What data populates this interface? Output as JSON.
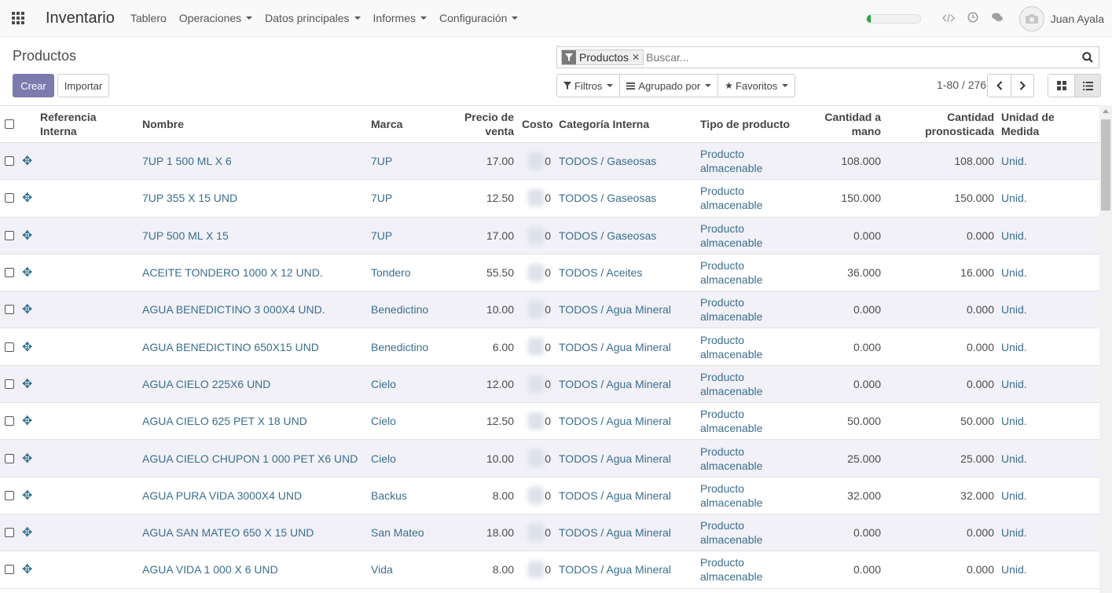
{
  "app": {
    "brand": "Inventario"
  },
  "menu": [
    {
      "label": "Tablero",
      "dropdown": false
    },
    {
      "label": "Operaciones",
      "dropdown": true
    },
    {
      "label": "Datos principales",
      "dropdown": true
    },
    {
      "label": "Informes",
      "dropdown": true
    },
    {
      "label": "Configuración",
      "dropdown": true
    }
  ],
  "user": {
    "name": "Juan Ayala"
  },
  "progress": {
    "fraction": 0.08,
    "color": "#28a745"
  },
  "page": {
    "title": "Productos"
  },
  "actions": {
    "create": "Crear",
    "import": "Importar"
  },
  "search": {
    "facet": "Productos",
    "placeholder": "Buscar..."
  },
  "filters": {
    "filters": "Filtros",
    "group_by": "Agrupado por",
    "favorites": "Favoritos"
  },
  "pager": {
    "value": "1-80 / 276"
  },
  "columns": {
    "ref": "Referencia Interna",
    "name": "Nombre",
    "brand": "Marca",
    "price": "Precio de venta",
    "cost": "Costo",
    "category": "Categoría Interna",
    "type": "Tipo de producto",
    "qty_hand": "Cantidad a mano",
    "qty_forecast": "Cantidad pronosticada",
    "uom": "Unidad de Medida"
  },
  "rows": [
    {
      "name": "7UP 1 500 ML X 6",
      "brand": "7UP",
      "price": "17.00",
      "cost": "0",
      "category": "TODOS / Gaseosas",
      "type": "Producto almacenable",
      "qty_hand": "108.000",
      "qty_forecast": "108.000",
      "uom": "Unid."
    },
    {
      "name": "7UP 355 X 15 UND",
      "brand": "7UP",
      "price": "12.50",
      "cost": "0",
      "category": "TODOS / Gaseosas",
      "type": "Producto almacenable",
      "qty_hand": "150.000",
      "qty_forecast": "150.000",
      "uom": "Unid."
    },
    {
      "name": "7UP 500 ML X 15",
      "brand": "7UP",
      "price": "17.00",
      "cost": "0",
      "category": "TODOS / Gaseosas",
      "type": "Producto almacenable",
      "qty_hand": "0.000",
      "qty_forecast": "0.000",
      "uom": "Unid."
    },
    {
      "name": "ACEITE TONDERO 1000 X 12 UND.",
      "brand": "Tondero",
      "price": "55.50",
      "cost": "0",
      "category": "TODOS / Aceites",
      "type": "Producto almacenable",
      "qty_hand": "36.000",
      "qty_forecast": "16.000",
      "uom": "Unid."
    },
    {
      "name": "AGUA BENEDICTINO 3 000X4 UND.",
      "brand": "Benedictino",
      "price": "10.00",
      "cost": "0",
      "category": "TODOS / Agua Mineral",
      "type": "Producto almacenable",
      "qty_hand": "0.000",
      "qty_forecast": "0.000",
      "uom": "Unid."
    },
    {
      "name": "AGUA BENEDICTINO 650X15 UND",
      "brand": "Benedictino",
      "price": "6.00",
      "cost": "0",
      "category": "TODOS / Agua Mineral",
      "type": "Producto almacenable",
      "qty_hand": "0.000",
      "qty_forecast": "0.000",
      "uom": "Unid."
    },
    {
      "name": "AGUA CIELO 225X6 UND",
      "brand": "Cielo",
      "price": "12.00",
      "cost": "0",
      "category": "TODOS / Agua Mineral",
      "type": "Producto almacenable",
      "qty_hand": "0.000",
      "qty_forecast": "0.000",
      "uom": "Unid."
    },
    {
      "name": "AGUA CIELO 625 PET X 18 UND",
      "brand": "Cielo",
      "price": "12.50",
      "cost": "0",
      "category": "TODOS / Agua Mineral",
      "type": "Producto almacenable",
      "qty_hand": "50.000",
      "qty_forecast": "50.000",
      "uom": "Unid."
    },
    {
      "name": "AGUA CIELO CHUPON 1 000 PET X6 UND",
      "brand": "Cielo",
      "price": "10.00",
      "cost": "0",
      "category": "TODOS / Agua Mineral",
      "type": "Producto almacenable",
      "qty_hand": "25.000",
      "qty_forecast": "25.000",
      "uom": "Unid."
    },
    {
      "name": "AGUA PURA VIDA 3000X4 UND",
      "brand": "Backus",
      "price": "8.00",
      "cost": "0",
      "category": "TODOS / Agua Mineral",
      "type": "Producto almacenable",
      "qty_hand": "32.000",
      "qty_forecast": "32.000",
      "uom": "Unid."
    },
    {
      "name": "AGUA SAN MATEO 650 X 15 UND",
      "brand": "San Mateo",
      "price": "18.00",
      "cost": "0",
      "category": "TODOS / Agua Mineral",
      "type": "Producto almacenable",
      "qty_hand": "0.000",
      "qty_forecast": "0.000",
      "uom": "Unid."
    },
    {
      "name": "AGUA VIDA 1 000 X 6 UND",
      "brand": "Vida",
      "price": "8.00",
      "cost": "0",
      "category": "TODOS / Agua Mineral",
      "type": "Producto almacenable",
      "qty_hand": "0.000",
      "qty_forecast": "0.000",
      "uom": "Unid."
    }
  ],
  "icons": [
    "apps-icon",
    "code-icon",
    "clock-icon",
    "chat-icon",
    "avatar-camera-icon",
    "filter-icon",
    "close-icon",
    "search-icon",
    "star-icon",
    "list-icon",
    "kanban-icon",
    "chevron-left-icon",
    "chevron-right-icon",
    "drag-handle-icon"
  ]
}
